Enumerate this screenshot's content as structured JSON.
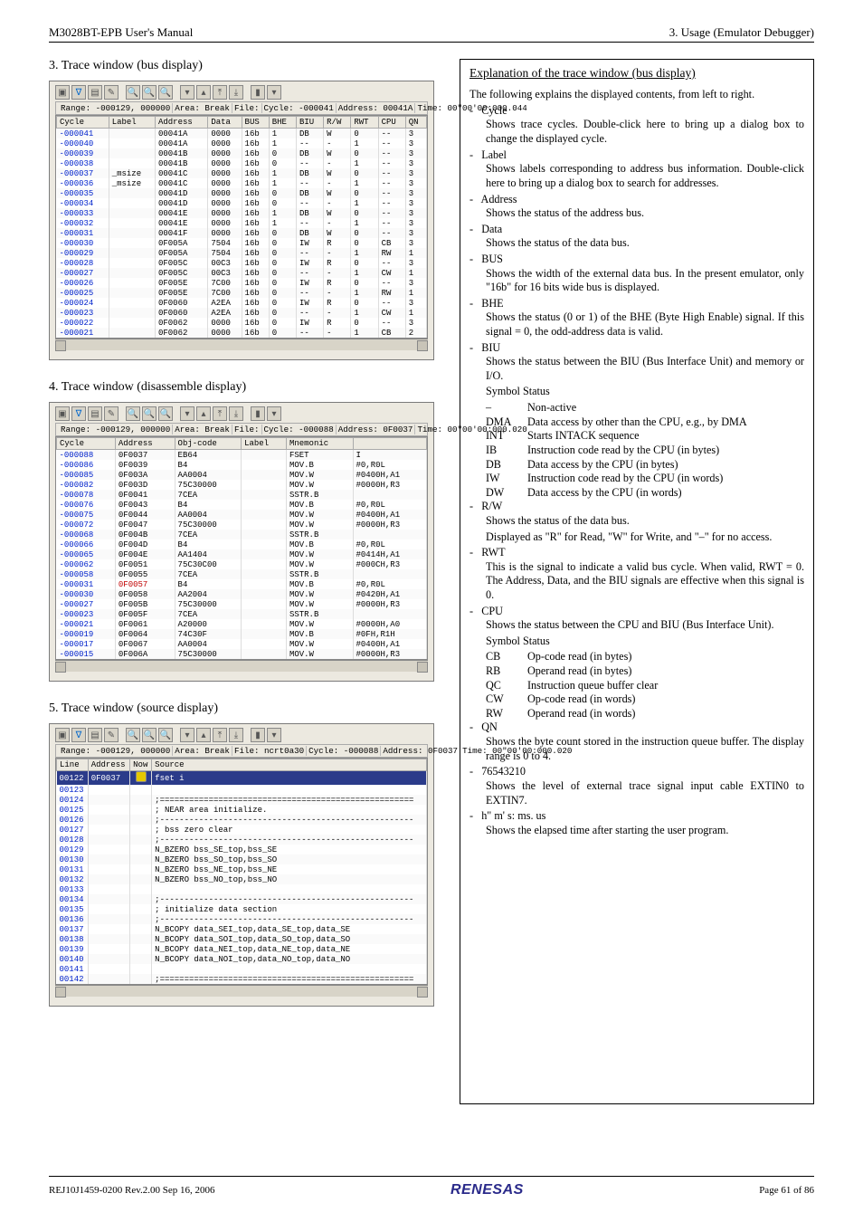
{
  "header": {
    "left": "M3028BT-EPB User's Manual",
    "right": "3. Usage (Emulator Debugger)"
  },
  "sections": {
    "s3": "3. Trace window (bus display)",
    "s4": "4. Trace window (disassemble display)",
    "s5": "5. Trace window (source display)"
  },
  "win3": {
    "status": [
      "Range: -000129, 000000",
      "Area: Break",
      "File:",
      "Cycle: -000041",
      "Address: 00041A",
      "Time: 00\"00'00:000.044"
    ],
    "cols": [
      "Cycle",
      "Label",
      "Address",
      "Data",
      "BUS",
      "BHE",
      "BIU",
      "R/W",
      "RWT",
      "CPU",
      "QN"
    ],
    "rows": [
      [
        "-000041",
        "",
        "00041A",
        "0000",
        "16b",
        "1",
        "DB",
        "W",
        "0",
        "--",
        "3"
      ],
      [
        "-000040",
        "",
        "00041A",
        "0000",
        "16b",
        "1",
        "--",
        "-",
        "1",
        "--",
        "3"
      ],
      [
        "-000039",
        "",
        "00041B",
        "0000",
        "16b",
        "0",
        "DB",
        "W",
        "0",
        "--",
        "3"
      ],
      [
        "-000038",
        "",
        "00041B",
        "0000",
        "16b",
        "0",
        "--",
        "-",
        "1",
        "--",
        "3"
      ],
      [
        "-000037",
        "_msize",
        "00041C",
        "0000",
        "16b",
        "1",
        "DB",
        "W",
        "0",
        "--",
        "3"
      ],
      [
        "-000036",
        "_msize",
        "00041C",
        "0000",
        "16b",
        "1",
        "--",
        "-",
        "1",
        "--",
        "3"
      ],
      [
        "-000035",
        "",
        "00041D",
        "0000",
        "16b",
        "0",
        "DB",
        "W",
        "0",
        "--",
        "3"
      ],
      [
        "-000034",
        "",
        "00041D",
        "0000",
        "16b",
        "0",
        "--",
        "-",
        "1",
        "--",
        "3"
      ],
      [
        "-000033",
        "",
        "00041E",
        "0000",
        "16b",
        "1",
        "DB",
        "W",
        "0",
        "--",
        "3"
      ],
      [
        "-000032",
        "",
        "00041E",
        "0000",
        "16b",
        "1",
        "--",
        "-",
        "1",
        "--",
        "3"
      ],
      [
        "-000031",
        "",
        "00041F",
        "0000",
        "16b",
        "0",
        "DB",
        "W",
        "0",
        "--",
        "3"
      ],
      [
        "-000030",
        "",
        "0F005A",
        "7504",
        "16b",
        "0",
        "IW",
        "R",
        "0",
        "CB",
        "3"
      ],
      [
        "-000029",
        "",
        "0F005A",
        "7504",
        "16b",
        "0",
        "--",
        "-",
        "1",
        "RW",
        "1"
      ],
      [
        "-000028",
        "",
        "0F005C",
        "00C3",
        "16b",
        "0",
        "IW",
        "R",
        "0",
        "--",
        "3"
      ],
      [
        "-000027",
        "",
        "0F005C",
        "00C3",
        "16b",
        "0",
        "--",
        "-",
        "1",
        "CW",
        "1"
      ],
      [
        "-000026",
        "",
        "0F005E",
        "7C00",
        "16b",
        "0",
        "IW",
        "R",
        "0",
        "--",
        "3"
      ],
      [
        "-000025",
        "",
        "0F005E",
        "7C00",
        "16b",
        "0",
        "--",
        "-",
        "1",
        "RW",
        "1"
      ],
      [
        "-000024",
        "",
        "0F0060",
        "A2EA",
        "16b",
        "0",
        "IW",
        "R",
        "0",
        "--",
        "3"
      ],
      [
        "-000023",
        "",
        "0F0060",
        "A2EA",
        "16b",
        "0",
        "--",
        "-",
        "1",
        "CW",
        "1"
      ],
      [
        "-000022",
        "",
        "0F0062",
        "0000",
        "16b",
        "0",
        "IW",
        "R",
        "0",
        "--",
        "3"
      ],
      [
        "-000021",
        "",
        "0F0062",
        "0000",
        "16b",
        "0",
        "--",
        "-",
        "1",
        "CB",
        "2"
      ]
    ]
  },
  "win4": {
    "status": [
      "Range: -000129, 000000",
      "Area: Break",
      "File:",
      "Cycle: -000088",
      "Address: 0F0037",
      "Time: 00\"00'00:000.020"
    ],
    "cols": [
      "Cycle",
      "Address",
      "Obj-code",
      "Label",
      "Mnemonic",
      ""
    ],
    "rows": [
      [
        "-000088",
        "0F0037",
        "EB64",
        "",
        "FSET",
        "I"
      ],
      [
        "-000086",
        "0F0039",
        "B4",
        "",
        "MOV.B",
        "#0,R0L"
      ],
      [
        "-000085",
        "0F003A",
        "AA0004",
        "",
        "MOV.W",
        "#0400H,A1"
      ],
      [
        "-000082",
        "0F003D",
        "75C30000",
        "",
        "MOV.W",
        "#0000H,R3"
      ],
      [
        "-000078",
        "0F0041",
        "7CEA",
        "",
        "SSTR.B",
        ""
      ],
      [
        "-000076",
        "0F0043",
        "B4",
        "",
        "MOV.B",
        "#0,R0L"
      ],
      [
        "-000075",
        "0F0044",
        "AA0004",
        "",
        "MOV.W",
        "#0400H,A1"
      ],
      [
        "-000072",
        "0F0047",
        "75C30000",
        "",
        "MOV.W",
        "#0000H,R3"
      ],
      [
        "-000068",
        "0F004B",
        "7CEA",
        "",
        "SSTR.B",
        ""
      ],
      [
        "-000066",
        "0F004D",
        "B4",
        "",
        "MOV.B",
        "#0,R0L"
      ],
      [
        "-000065",
        "0F004E",
        "AA1404",
        "",
        "MOV.W",
        "#0414H,A1"
      ],
      [
        "-000062",
        "0F0051",
        "75C30C00",
        "",
        "MOV.W",
        "#000CH,R3"
      ],
      [
        "-000058",
        "0F0055",
        "7CEA",
        "",
        "SSTR.B",
        ""
      ],
      [
        "-000031",
        "0F0057",
        "B4",
        "",
        "MOV.B",
        "#0,R0L"
      ],
      [
        "-000030",
        "0F0058",
        "AA2004",
        "",
        "MOV.W",
        "#0420H,A1"
      ],
      [
        "-000027",
        "0F005B",
        "75C30000",
        "",
        "MOV.W",
        "#0000H,R3"
      ],
      [
        "-000023",
        "0F005F",
        "7CEA",
        "",
        "SSTR.B",
        ""
      ],
      [
        "-000021",
        "0F0061",
        "A20000",
        "",
        "MOV.W",
        "#0000H,A0"
      ],
      [
        "-000019",
        "0F0064",
        "74C30F",
        "",
        "MOV.B",
        "#0FH,R1H"
      ],
      [
        "-000017",
        "0F0067",
        "AA0004",
        "",
        "MOV.W",
        "#0400H,A1"
      ],
      [
        "-000015",
        "0F006A",
        "75C30000",
        "",
        "MOV.W",
        "#0000H,R3"
      ]
    ],
    "hl_addr": "0F0057"
  },
  "win5": {
    "status": [
      "Range: -000129, 000000",
      "Area: Break",
      "File: ncrt0a30",
      "Cycle: -000088",
      "Address: 0F0037",
      "Time: 00\"00'00:000.020"
    ],
    "cols": [
      "Line",
      "Address",
      "Now",
      "Source"
    ],
    "rows": [
      [
        "00122",
        "0F0037",
        "now",
        "        fset    i"
      ],
      [
        "00123",
        "",
        "",
        ""
      ],
      [
        "00124",
        "",
        "",
        ";===================================================="
      ],
      [
        "00125",
        "",
        "",
        "; NEAR area initialize."
      ],
      [
        "00126",
        "",
        "",
        ";----------------------------------------------------"
      ],
      [
        "00127",
        "",
        "",
        "; bss zero clear"
      ],
      [
        "00128",
        "",
        "",
        ";----------------------------------------------------"
      ],
      [
        "00129",
        "",
        "",
        "        N_BZERO bss_SE_top,bss_SE"
      ],
      [
        "00130",
        "",
        "",
        "        N_BZERO bss_SO_top,bss_SO"
      ],
      [
        "00131",
        "",
        "",
        "        N_BZERO bss_NE_top,bss_NE"
      ],
      [
        "00132",
        "",
        "",
        "        N_BZERO bss_NO_top,bss_NO"
      ],
      [
        "00133",
        "",
        "",
        ""
      ],
      [
        "00134",
        "",
        "",
        ";----------------------------------------------------"
      ],
      [
        "00135",
        "",
        "",
        "; initialize data section"
      ],
      [
        "00136",
        "",
        "",
        ";----------------------------------------------------"
      ],
      [
        "00137",
        "",
        "",
        "        N_BCOPY data_SEI_top,data_SE_top,data_SE"
      ],
      [
        "00138",
        "",
        "",
        "        N_BCOPY data_SOI_top,data_SO_top,data_SO"
      ],
      [
        "00139",
        "",
        "",
        "        N_BCOPY data_NEI_top,data_NE_top,data_NE"
      ],
      [
        "00140",
        "",
        "",
        "        N_BCOPY data_NOI_top,data_NO_top,data_NO"
      ],
      [
        "00141",
        "",
        "",
        ""
      ],
      [
        "00142",
        "",
        "",
        ";===================================================="
      ]
    ]
  },
  "expl": {
    "title": "Explanation of the trace window (bus display)",
    "intro": "The following explains the displayed contents, from left to right.",
    "items": [
      {
        "h": "Cycle",
        "body": [
          "Shows trace cycles. Double-click here to bring up a dialog box to change the displayed cycle."
        ]
      },
      {
        "h": "Label",
        "body": [
          "Shows labels corresponding to address bus information. Double-click here to bring up a dialog box to search for addresses."
        ]
      },
      {
        "h": "Address",
        "body": [
          "Shows the status of the address bus."
        ]
      },
      {
        "h": "Data",
        "body": [
          "Shows the status of the data bus."
        ]
      },
      {
        "h": "BUS",
        "body": [
          "Shows the width of the external data bus. In the present emulator, only \"16b\" for 16 bits wide bus is displayed."
        ]
      },
      {
        "h": "BHE",
        "body": [
          "Shows the status (0 or 1) of the BHE (Byte High Enable) signal. If this signal = 0, the odd-address data is valid."
        ]
      },
      {
        "h": "BIU",
        "body": [
          "Shows the status between the BIU (Bus Interface Unit) and memory or I/O.",
          "Symbol  Status"
        ],
        "syms": [
          [
            "–",
            "Non-active"
          ],
          [
            "DMA",
            "Data access by other than the CPU, e.g., by DMA"
          ],
          [
            "INT",
            "Starts INTACK sequence"
          ],
          [
            "IB",
            "Instruction code read by the CPU (in bytes)"
          ],
          [
            "DB",
            "Data access by the CPU (in bytes)"
          ],
          [
            "IW",
            "Instruction code read by the CPU (in words)"
          ],
          [
            "DW",
            "Data access by the CPU (in words)"
          ]
        ]
      },
      {
        "h": "R/W",
        "body": [
          "Shows the status of the data bus.",
          "Displayed as \"R\" for Read, \"W\" for Write, and \"–\" for no access."
        ]
      },
      {
        "h": "RWT",
        "body": [
          "This is the signal to indicate a valid bus cycle. When valid, RWT = 0. The Address, Data, and the BIU signals are effective when this signal is 0."
        ]
      },
      {
        "h": "CPU",
        "body": [
          "Shows the status between the CPU and BIU (Bus Interface Unit).",
          "Symbol  Status"
        ],
        "syms": [
          [
            "CB",
            "Op-code read (in bytes)"
          ],
          [
            "RB",
            "Operand read (in bytes)"
          ],
          [
            "QC",
            "Instruction queue buffer clear"
          ],
          [
            "CW",
            "Op-code read (in words)"
          ],
          [
            "RW",
            "Operand read (in words)"
          ]
        ]
      },
      {
        "h": "QN",
        "body": [
          "Shows the byte count stored in the instruction queue buffer. The display range is 0 to 4."
        ]
      },
      {
        "h": "76543210",
        "body": [
          "Shows the level of external trace signal input cable EXTIN0 to EXTIN7."
        ]
      },
      {
        "h": "h\" m' s: ms. us",
        "body": [
          "Shows the elapsed time after starting the user program."
        ]
      }
    ]
  },
  "footer": {
    "left": "REJ10J1459-0200   Rev.2.00   Sep 16, 2006",
    "brand": "RENESAS",
    "right": "Page 61 of 86"
  }
}
